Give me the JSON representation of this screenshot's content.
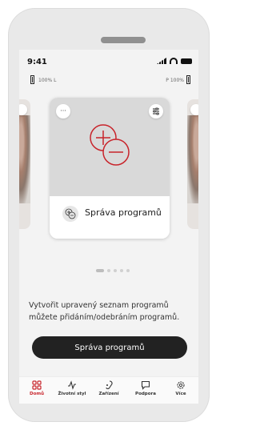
{
  "status_bar": {
    "time": "9:41"
  },
  "hearing": {
    "left_percent": "100%",
    "left_side": "L",
    "right_side": "P",
    "right_percent": "100%"
  },
  "card": {
    "title": "Správa programů"
  },
  "description": "Vytvořit upravený seznam programů můžete přidáním/odebráním programů.",
  "cta_label": "Správa programů",
  "tabs": [
    {
      "label": "Domů",
      "icon": "home-grid-icon",
      "active": true
    },
    {
      "label": "Životní styl",
      "icon": "pulse-icon",
      "active": false
    },
    {
      "label": "Zařízení",
      "icon": "hearing-device-icon",
      "active": false
    },
    {
      "label": "Podpora",
      "icon": "chat-icon",
      "active": false
    },
    {
      "label": "Více",
      "icon": "gear-icon",
      "active": false
    }
  ],
  "colors": {
    "accent": "#c8242b",
    "cta": "#222222",
    "card_image": "#d9d9d9"
  }
}
